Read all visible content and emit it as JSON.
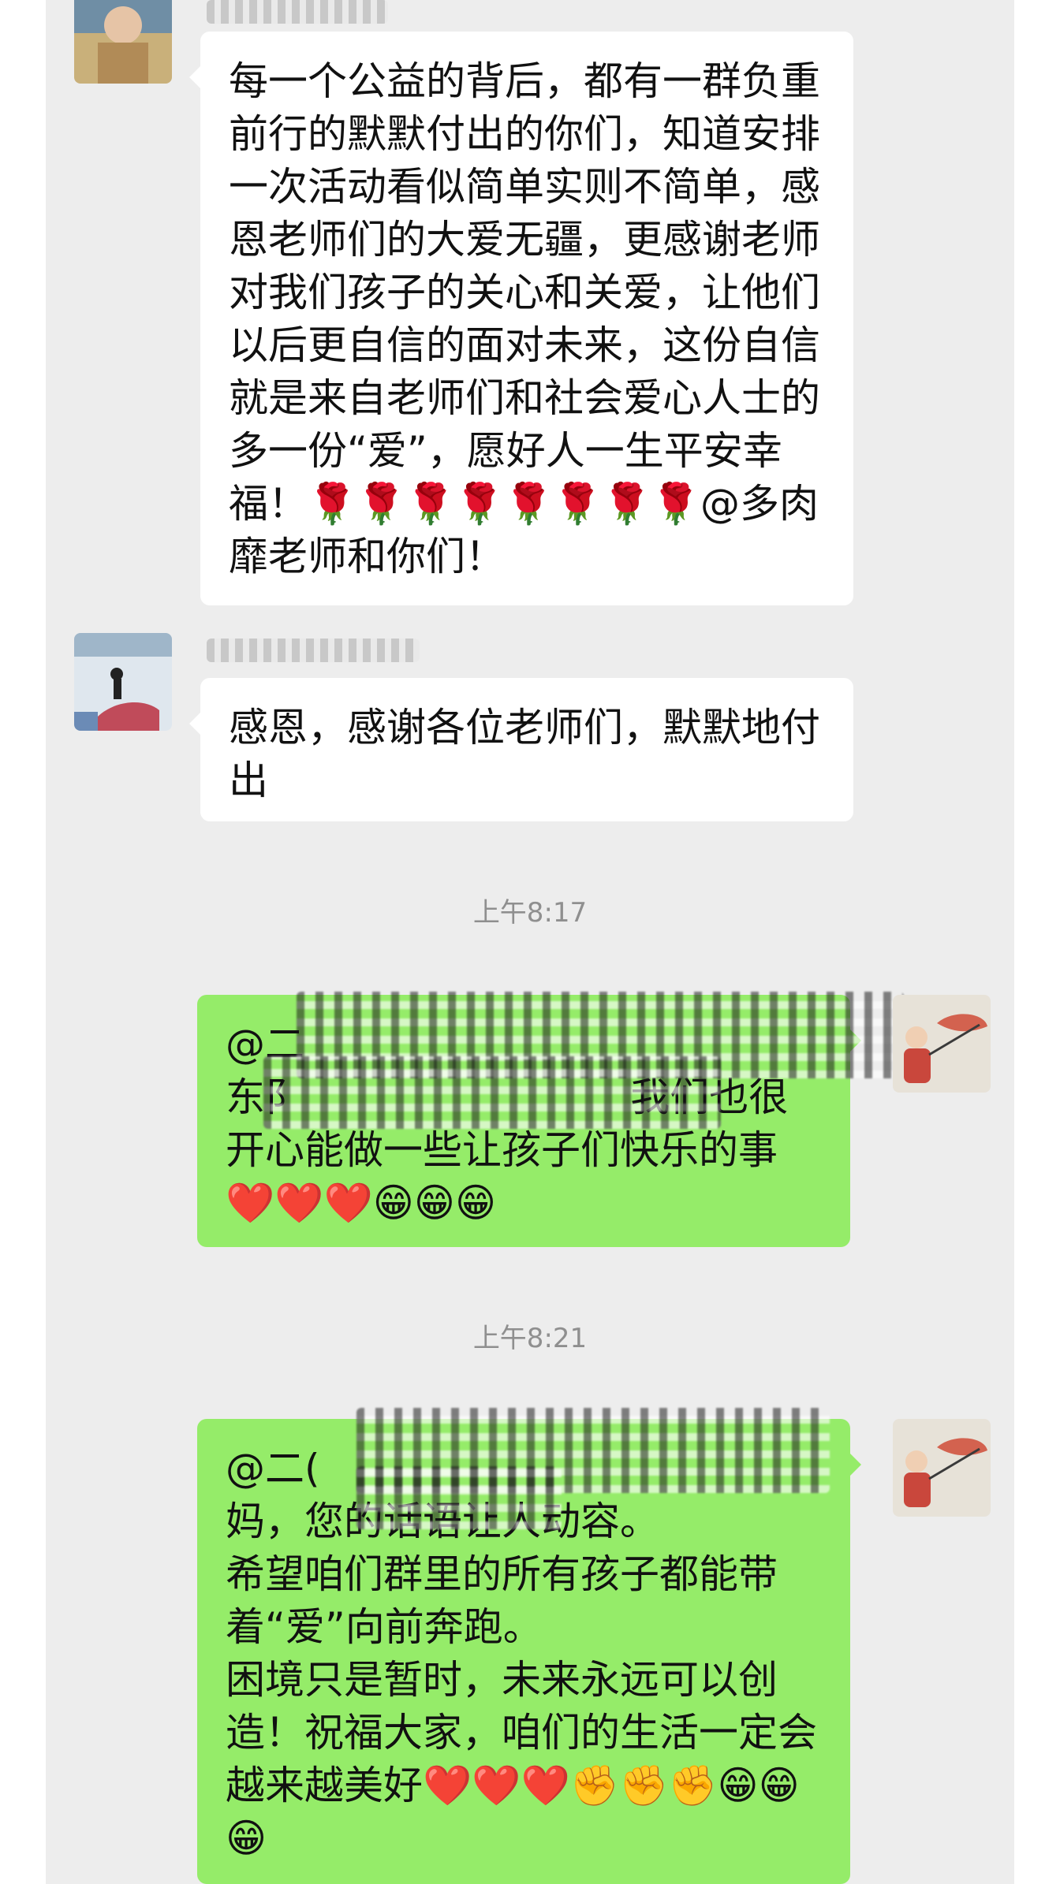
{
  "messages": [
    {
      "text": "每一个公益的背后，都有一群负重前行的默默付出的你们，知道安排一次活动看似简单实则不简单，感恩老师们的大爱无疆，更感谢老师对我们孩子的关心和关爱，让他们以后更自信的面对未来，这份自信就是来自老师们和社会爱心人士的多一份“爱”，愿好人一生平安幸福！🌹🌹🌹🌹🌹🌹🌹🌹@多肉靡老师和你们！"
    },
    {
      "text": "感恩，感谢各位老师们，默默地付出"
    },
    {
      "timestamp": "上午8:17",
      "text": "@二                                        东阝                          我们也很开心能做一些让孩子们快乐的事❤️❤️❤️😁😁😁"
    },
    {
      "timestamp": "上午8:21",
      "text": "@二(                                              妈，您的话语让人动容。\n希望咱们群里的所有孩子都能带着“爱”向前奔跑。\n困境只是暂时，未来永远可以创造！祝福大家，咱们的生活一定会越来越美好❤️❤️❤️✊✊✊😁😁😁"
    }
  ]
}
